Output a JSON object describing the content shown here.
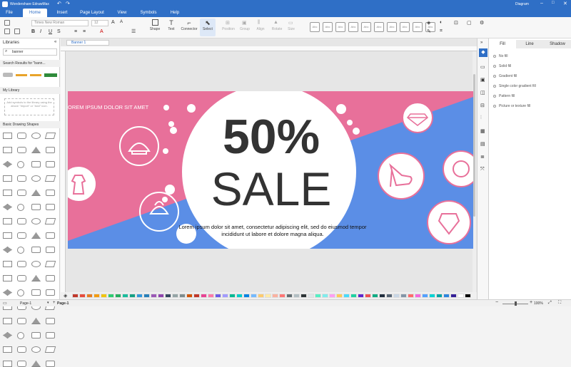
{
  "app": {
    "title": "Wondershare EdrawMax",
    "user": "Diagram"
  },
  "menu": [
    "File",
    "Home",
    "Insert",
    "Page Layout",
    "View",
    "Symbols",
    "Help"
  ],
  "ribbon": {
    "font_name": "Times New Roman",
    "font_size": "12",
    "tools": [
      "Shape",
      "Text",
      "Connector",
      "Select"
    ],
    "disabled_tools": [
      "Position",
      "Group",
      "Align",
      "Rotate",
      "Size"
    ],
    "style_label": "Abc"
  },
  "left_panel": {
    "title": "Libraries",
    "search_value": "banner",
    "search_results": "Search Results for \"bann...",
    "my_library": "My Library",
    "my_library_hint": "Add symbols to the library using the above \"Import\" or \"Add\" icon.",
    "basic_shapes": "Basic Drawing Shapes"
  },
  "doc_tab": "Banner 1",
  "banner": {
    "tagline": "OREM IPSUM DOLOR SIT AMET",
    "big_number": "50%",
    "big_word": "SALE",
    "body": "Lorem ipsum dolor sit amet, consectetur adipiscing elit, sed do eiusmod tempor incididunt ut labore et dolore magna aliqua.",
    "pink": "#e8709a",
    "blue": "#5b8ee6"
  },
  "right_panel": {
    "tabs": [
      "Fill",
      "Line",
      "Shadow"
    ],
    "options": [
      "No fill",
      "Solid fill",
      "Gradient fill",
      "Single color gradient fill",
      "Pattern fill",
      "Picture or texture fill"
    ]
  },
  "status": {
    "page_selector": "Page-1",
    "page_tab": "Page-1",
    "zoom": "100%"
  },
  "palette": [
    "#c0392b",
    "#e74c3c",
    "#e67e22",
    "#f39c12",
    "#f1c40f",
    "#2ecc71",
    "#27ae60",
    "#1abc9c",
    "#16a085",
    "#3498db",
    "#2980b9",
    "#9b59b6",
    "#8e44ad",
    "#34495e",
    "#95a5a6",
    "#7f8c8d",
    "#d35400",
    "#c0392b",
    "#e84393",
    "#fd79a8",
    "#6c5ce7",
    "#a29bfe",
    "#00b894",
    "#00cec9",
    "#0984e3",
    "#74b9ff",
    "#fdcb6e",
    "#ffeaa7",
    "#fab1a0",
    "#ff7675",
    "#636e72",
    "#b2bec3",
    "#2d3436",
    "#dfe6e9",
    "#55efc4",
    "#81ecec",
    "#ff9ff3",
    "#feca57",
    "#48dbfb",
    "#1dd1a1",
    "#5f27cd",
    "#ee5253",
    "#10ac84",
    "#222f3e",
    "#576574",
    "#c8d6e5",
    "#8395a7",
    "#ff6b6b",
    "#f368e0",
    "#54a0ff",
    "#00d2d3",
    "#01a3a4",
    "#2e86de",
    "#341f97",
    "#ffffff",
    "#000000"
  ]
}
